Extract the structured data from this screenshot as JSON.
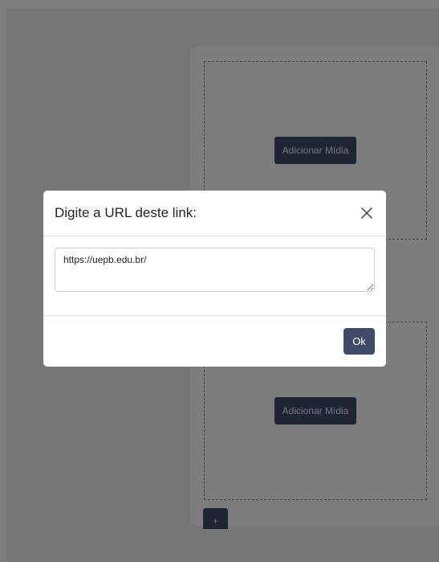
{
  "background": {
    "media_button_1": "Adicionar Mídia",
    "media_button_2": "Adicionar Mídia",
    "add_button": "+"
  },
  "modal": {
    "title": "Digite a URL deste link:",
    "url_value": "https://uepb.edu.br/",
    "ok_label": "Ok",
    "close_icon": "close-icon"
  },
  "colors": {
    "accent": "#404a6b",
    "overlay": "rgba(0,0,0,0.5)"
  }
}
